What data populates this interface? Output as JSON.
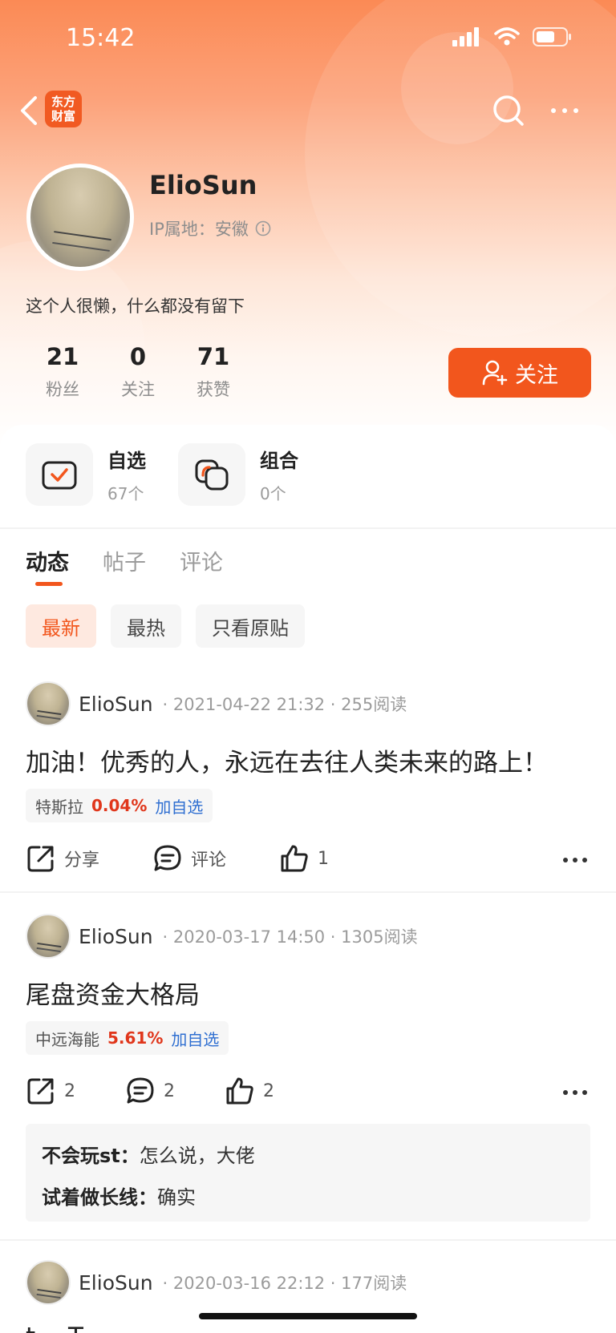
{
  "status_bar": {
    "time": "15:42"
  },
  "nav": {
    "app_logo_line1": "东方",
    "app_logo_line2": "财富"
  },
  "profile": {
    "name": "ElioSun",
    "ip_location": "IP属地：安徽",
    "bio": "这个人很懒，什么都没有留下",
    "stats": [
      {
        "num": "21",
        "label": "粉丝"
      },
      {
        "num": "0",
        "label": "关注"
      },
      {
        "num": "71",
        "label": "获赞"
      }
    ],
    "follow_label": "关注"
  },
  "quick": [
    {
      "title": "自选",
      "sub": "67个",
      "icon": "checkbox-icon"
    },
    {
      "title": "组合",
      "sub": "0个",
      "icon": "portfolio-icon"
    }
  ],
  "tabs": [
    "动态",
    "帖子",
    "评论"
  ],
  "filters": [
    "最新",
    "最热",
    "只看原贴"
  ],
  "posts": [
    {
      "author": "ElioSun",
      "meta": "· 2021-04-22 21:32 · 255阅读",
      "title": "加油！优秀的人，永远在去往人类未来的路上！",
      "stock": {
        "name": "特斯拉",
        "pct": "0.04%",
        "add": "加自选"
      },
      "share": "分享",
      "comment": "评论",
      "like": "1"
    },
    {
      "author": "ElioSun",
      "meta": "· 2020-03-17 14:50 · 1305阅读",
      "title": "尾盘资金大格局",
      "stock": {
        "name": "中远海能",
        "pct": "5.61%",
        "add": "加自选"
      },
      "share": "2",
      "comment": "2",
      "like": "2",
      "comments": [
        {
          "user": "不会玩st：",
          "text": "怎么说，大佬"
        },
        {
          "user": "试着做长线：",
          "text": "确实"
        }
      ]
    },
    {
      "author": "ElioSun",
      "meta": "· 2020-03-16 22:12 · 177阅读",
      "title": "t… T…"
    }
  ]
}
